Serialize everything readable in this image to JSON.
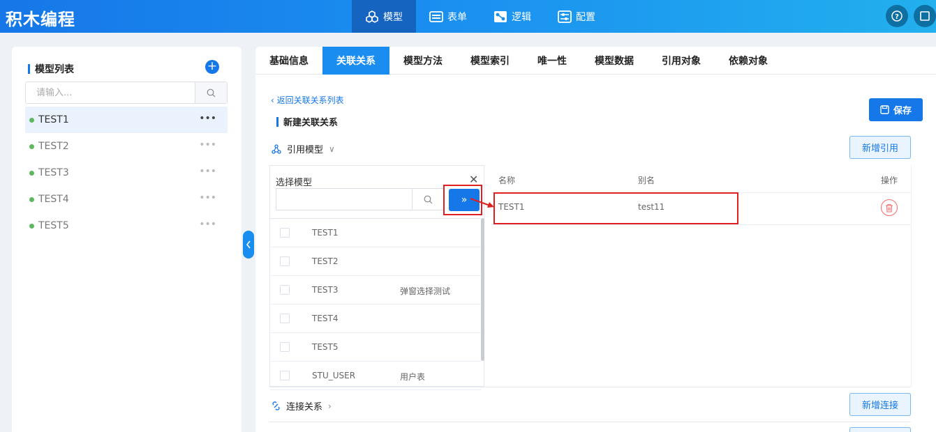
{
  "app": {
    "title": "积木编程"
  },
  "nav": [
    {
      "label": "模型",
      "icon": "cubes-icon",
      "active": true
    },
    {
      "label": "表单",
      "icon": "form-icon",
      "active": false
    },
    {
      "label": "逻辑",
      "icon": "logic-icon",
      "active": false
    },
    {
      "label": "配置",
      "icon": "config-icon",
      "active": false
    }
  ],
  "sidebar": {
    "title": "模型列表",
    "search_placeholder": "请输入...",
    "items": [
      {
        "label": "TEST1",
        "active": true
      },
      {
        "label": "TEST2",
        "active": false
      },
      {
        "label": "TEST3",
        "active": false
      },
      {
        "label": "TEST4",
        "active": false
      },
      {
        "label": "TEST5",
        "active": false
      }
    ],
    "more_label": "•••"
  },
  "tabs": [
    {
      "label": "基础信息",
      "active": false
    },
    {
      "label": "关联关系",
      "active": true
    },
    {
      "label": "模型方法",
      "active": false
    },
    {
      "label": "模型索引",
      "active": false
    },
    {
      "label": "唯一性",
      "active": false
    },
    {
      "label": "模型数据",
      "active": false
    },
    {
      "label": "引用对象",
      "active": false
    },
    {
      "label": "依赖对象",
      "active": false
    }
  ],
  "main": {
    "back_link": "返回关联关系列表",
    "section_title": "新建关联关系",
    "save_label": "保存",
    "ref_group_label": "引用模型",
    "add_ref_label": "新增引用",
    "conn_group_label": "连接关系",
    "add_conn_label": "新增连接",
    "selector": {
      "title": "选择模型",
      "rows": [
        {
          "name": "TEST1",
          "alias": ""
        },
        {
          "name": "TEST2",
          "alias": ""
        },
        {
          "name": "TEST3",
          "alias": "弹窗选择测试"
        },
        {
          "name": "TEST4",
          "alias": ""
        },
        {
          "name": "TEST5",
          "alias": ""
        },
        {
          "name": "STU_USER",
          "alias": "用户表"
        }
      ]
    },
    "ref_table": {
      "col_name": "名称",
      "col_alias": "别名",
      "col_action": "操作",
      "rows": [
        {
          "name": "TEST1",
          "alias": "test11"
        }
      ]
    }
  },
  "colors": {
    "primary": "#1677e8",
    "highlight": "#e02020",
    "status_dot": "#5cb85c"
  }
}
